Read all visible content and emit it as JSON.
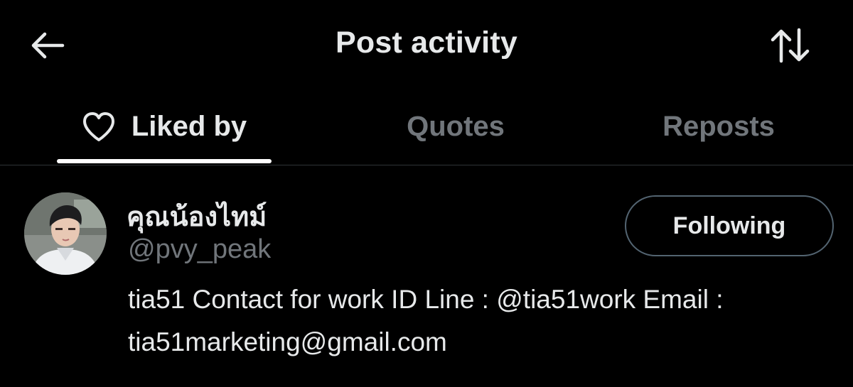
{
  "header": {
    "title": "Post activity",
    "back_icon": "arrow-left-icon",
    "sort_icon": "sort-arrows-icon"
  },
  "tabs": [
    {
      "label": "Liked by",
      "icon": "heart-icon",
      "selected": true
    },
    {
      "label": "Quotes",
      "selected": false
    },
    {
      "label": "Reposts",
      "selected": false
    }
  ],
  "users": [
    {
      "display_name": "คุณน้องไทม์",
      "handle": "@pvy_peak",
      "follow_label": "Following",
      "bio_line1": "tia51 Contact for work ID Line : @tia51work Email :",
      "bio_line2": "tia51marketing@gmail.com"
    }
  ],
  "colors": {
    "background": "#000000",
    "primary_text": "#e7e9ea",
    "secondary_text": "#71767b",
    "divider": "#2f3336",
    "tab_indicator": "#ffffff"
  }
}
